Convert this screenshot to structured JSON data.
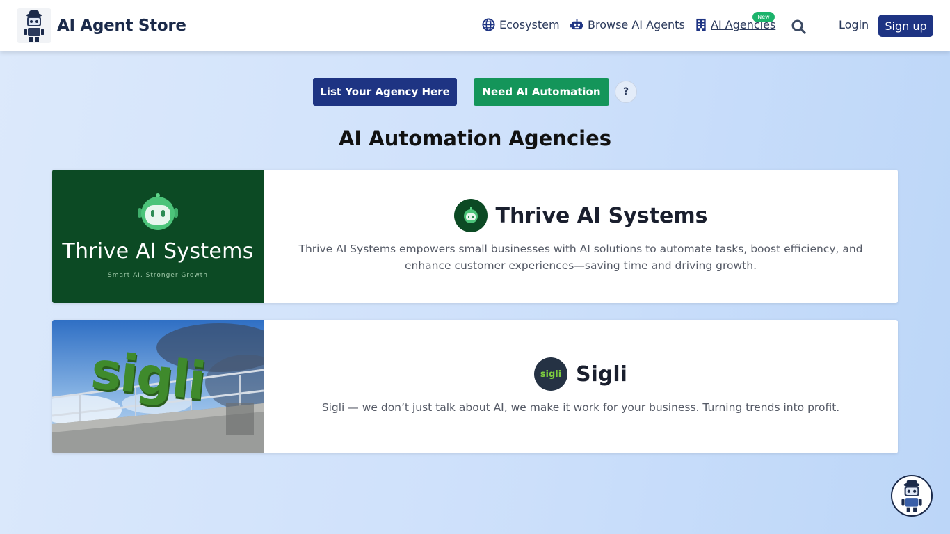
{
  "header": {
    "brand_title": "AI Agent Store",
    "nav": {
      "ecosystem": "Ecosystem",
      "browse": "Browse AI Agents",
      "agencies": "AI Agencies",
      "agencies_badge": "New"
    },
    "login": "Login",
    "signup": "Sign up"
  },
  "actions": {
    "list_agency": "List Your Agency Here",
    "need_automation": "Need AI Automation",
    "help": "?"
  },
  "page_title": "AI Automation Agencies",
  "agencies": [
    {
      "name": "Thrive AI Systems",
      "description": "Thrive AI Systems empowers small businesses with AI solutions to automate tasks, boost efficiency, and enhance customer experiences—saving time and driving growth.",
      "image_title": "Thrive AI Systems",
      "image_tagline": "Smart AI, Stronger Growth"
    },
    {
      "name": "Sigli",
      "description": "Sigli — we don’t just talk about AI, we make it work for your business. Turning trends into profit.",
      "image_word": "sigli",
      "logo_text": "sigli"
    }
  ],
  "colors": {
    "primary": "#1e3483",
    "green": "#14955a",
    "badge": "#1bb36b",
    "thrive_bg": "#0c4a24"
  }
}
